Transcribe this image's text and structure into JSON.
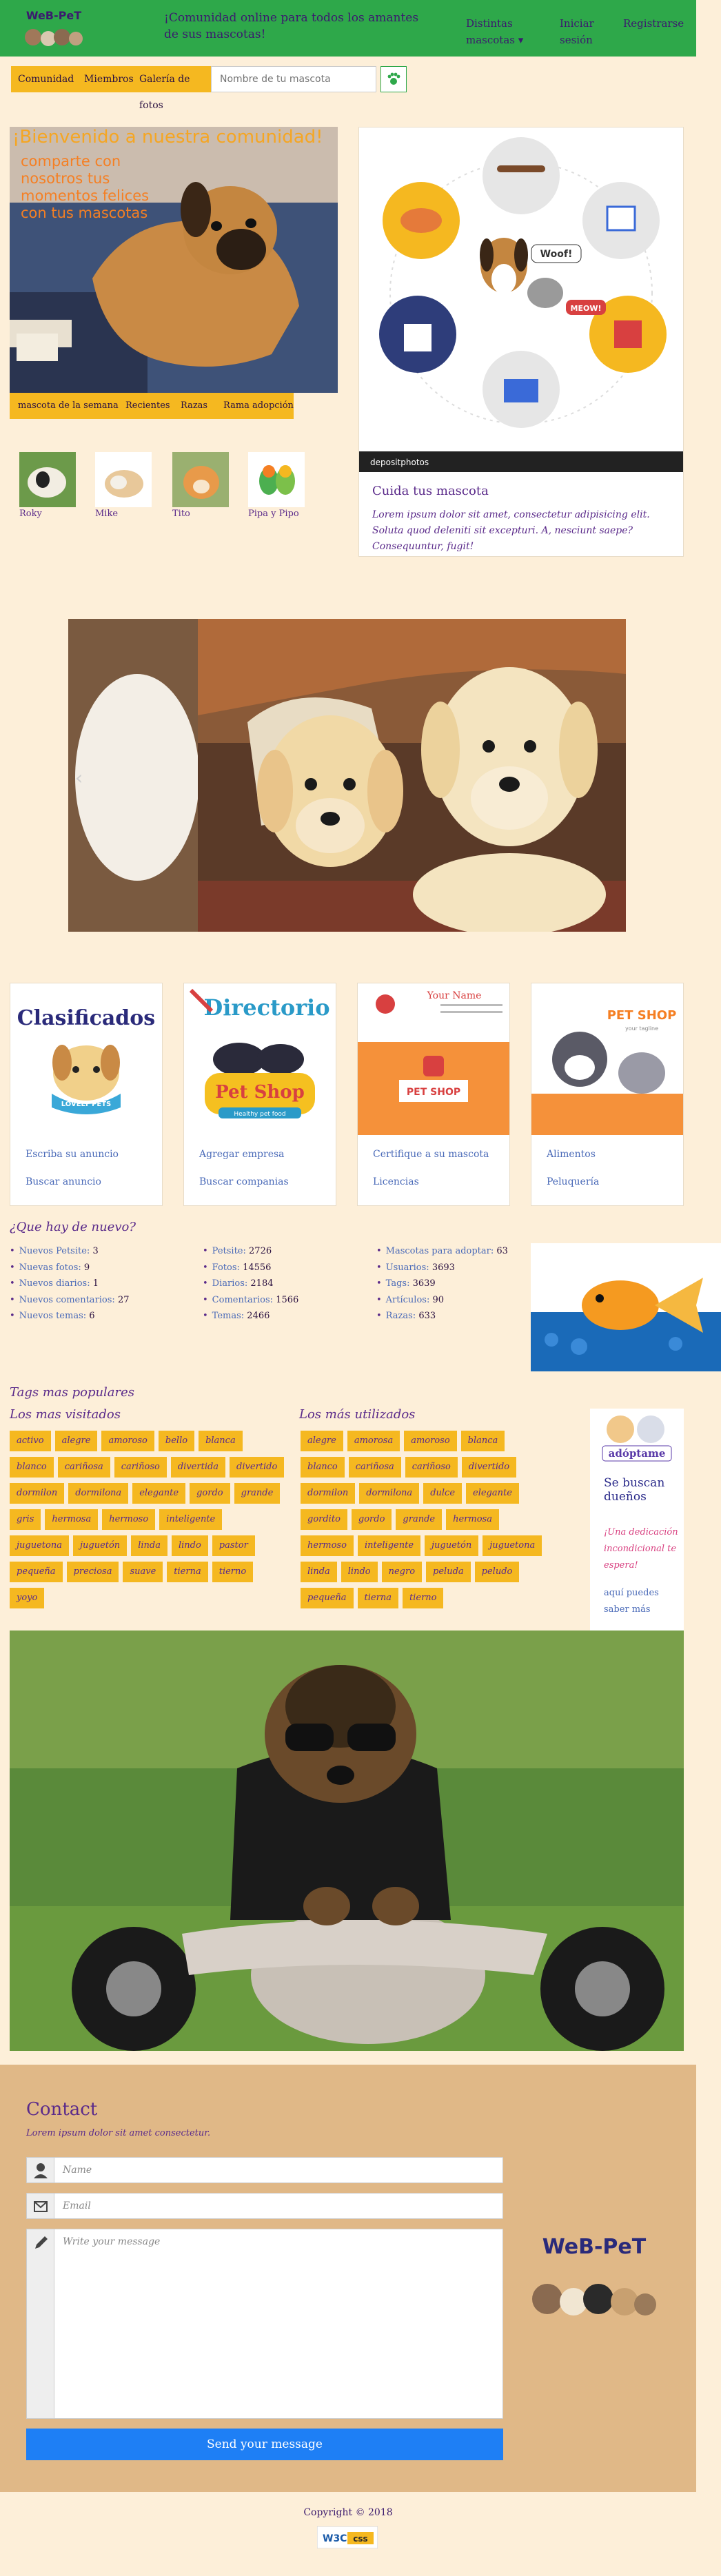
{
  "header": {
    "tagline": "¡Comunidad online para todos los amantes de sus mascotas!",
    "nav": [
      {
        "label": "Distintas mascotas",
        "caret": "▾"
      },
      {
        "label": "Iniciar sesión"
      },
      {
        "label": "Registrarse"
      }
    ],
    "logo_text": "WeB-PeT"
  },
  "subnav": {
    "items": [
      "Comunidad",
      "Miembros",
      "Galería de fotos"
    ],
    "search_placeholder": "Nombre de tu mascota"
  },
  "hero": {
    "title": "¡Bienvenido a nuestra comunidad!",
    "subtitle": "comparte con nosotros tus momentos felices con tus mascotas",
    "tabs": [
      "mascota de la semana",
      "Recientes",
      "Razas",
      "Rama adopción"
    ]
  },
  "pets": [
    {
      "name": "Roky"
    },
    {
      "name": "Mike"
    },
    {
      "name": "Tito"
    },
    {
      "name": "Pipa y Pipo"
    }
  ],
  "care": {
    "watermark": "depositphotos",
    "woof": "Woof!",
    "meow": "MEOW!",
    "title": "Cuida tus mascota",
    "text": "Lorem ipsum dolor sit amet, consectetur adipisicing elit. Soluta quod deleniti sit excepturi. A, nesciunt saepe? Consequuntur, fugit!"
  },
  "cards": [
    {
      "img_title": "Clasificados",
      "img_sub": "LOVELY PETS",
      "link1": "Escriba su anuncio",
      "link2": "Buscar anuncio"
    },
    {
      "img_title": "Directorio",
      "img_sub": "Pet Shop",
      "img_sub2": "Healthy pet food",
      "link1": "Agregar empresa",
      "link2": "Buscar companias"
    },
    {
      "img_title": "Your Name",
      "img_sub": "PET SHOP",
      "link1": "Certifique a su mascota",
      "link2": "Licencias"
    },
    {
      "img_title": "PET SHOP",
      "img_sub": "your tagline",
      "link1": "Alimentos",
      "link2": "Peluquería"
    }
  ],
  "news": {
    "title": "¿Que hay de nuevo?",
    "col1": [
      {
        "k": "Nuevos Petsite:",
        "v": "3"
      },
      {
        "k": "Nuevas fotos:",
        "v": "9"
      },
      {
        "k": "Nuevos diarios:",
        "v": "1"
      },
      {
        "k": "Nuevos comentarios:",
        "v": "27"
      },
      {
        "k": "Nuevos temas:",
        "v": "6"
      }
    ],
    "col2": [
      {
        "k": "Petsite:",
        "v": "2726"
      },
      {
        "k": "Fotos:",
        "v": "14556"
      },
      {
        "k": "Diarios:",
        "v": "2184"
      },
      {
        "k": "Comentarios:",
        "v": "1566"
      },
      {
        "k": "Temas:",
        "v": "2466"
      }
    ],
    "col3": [
      {
        "k": "Mascotas para adoptar:",
        "v": "63"
      },
      {
        "k": "Usuarios:",
        "v": "3693"
      },
      {
        "k": "Tags:",
        "v": "3639"
      },
      {
        "k": "Artículos:",
        "v": "90"
      },
      {
        "k": "Razas:",
        "v": "633"
      }
    ]
  },
  "tags": {
    "title": "Tags mas populares",
    "visited_title": "Los mas visitados",
    "visited": [
      "activo",
      "alegre",
      "amoroso",
      "bello",
      "blanca",
      "blanco",
      "cariñosa",
      "cariñoso",
      "divertida",
      "divertido",
      "dormilon",
      "dormilona",
      "elegante",
      "gordo",
      "grande",
      "gris",
      "hermosa",
      "hermoso",
      "inteligente",
      "juguetona",
      "juguetón",
      "linda",
      "lindo",
      "pastor",
      "pequeña",
      "preciosa",
      "suave",
      "tierna",
      "tierno",
      "yoyo"
    ],
    "used_title": "Los más utilizados",
    "used": [
      "alegre",
      "amorosa",
      "amoroso",
      "blanca",
      "blanco",
      "cariñosa",
      "cariñoso",
      "divertido",
      "dormilon",
      "dormilona",
      "dulce",
      "elegante",
      "gordito",
      "gordo",
      "grande",
      "hermosa",
      "hermoso",
      "inteligente",
      "juguetón",
      "juguetona",
      "linda",
      "lindo",
      "negro",
      "peluda",
      "peludo",
      "pequeña",
      "tierna",
      "tierno"
    ]
  },
  "adopt": {
    "badge": "adóptame",
    "title": "Se buscan dueños",
    "text": "¡Una dedicación incondicional te espera!",
    "link": "aquí puedes saber más"
  },
  "contact": {
    "title": "Contact",
    "subtitle": "Lorem ipsum dolor sit amet consectetur.",
    "name_placeholder": "Name",
    "email_placeholder": "Email",
    "message_placeholder": "Write your message",
    "send_label": "Send your message",
    "logo_text": "WeB-PeT"
  },
  "footer": {
    "copyright": "Copyright © 2018",
    "badge_w3c": "W3C",
    "badge_css": "css"
  },
  "colors": {
    "header": "#2ea84a",
    "accent": "#f5b820",
    "background": "#fdefd9",
    "contact": "#e0b887",
    "button": "#1e7ff5",
    "text": "#5a2a8a"
  }
}
